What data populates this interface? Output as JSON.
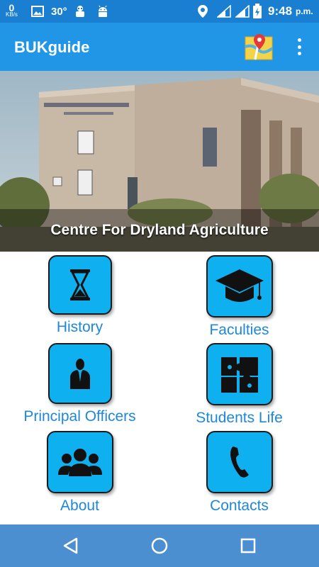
{
  "status_bar": {
    "speed_value": "0",
    "speed_unit": "KB/s",
    "temperature": "30°",
    "time": "9:48",
    "time_suffix": "p.m."
  },
  "app_bar": {
    "title": "BUKguide",
    "map_icon": "map-location-icon",
    "menu_icon": "overflow-menu-icon"
  },
  "banner": {
    "caption": "Centre For Dryland Agriculture"
  },
  "menu": {
    "items": [
      {
        "label": "History",
        "icon": "hourglass-icon"
      },
      {
        "label": "Faculties",
        "icon": "graduation-cap-icon"
      },
      {
        "label": "Principal Officers",
        "icon": "officer-icon"
      },
      {
        "label": "Students Life",
        "icon": "puzzle-icon"
      },
      {
        "label": "About",
        "icon": "group-icon"
      },
      {
        "label": "Contacts",
        "icon": "phone-icon"
      }
    ]
  },
  "colors": {
    "status_bar": "#1a7fd1",
    "app_bar": "#2196e6",
    "tile": "#0fb0f0",
    "label": "#1e88d6",
    "nav_bar": "#4b8fd0"
  }
}
